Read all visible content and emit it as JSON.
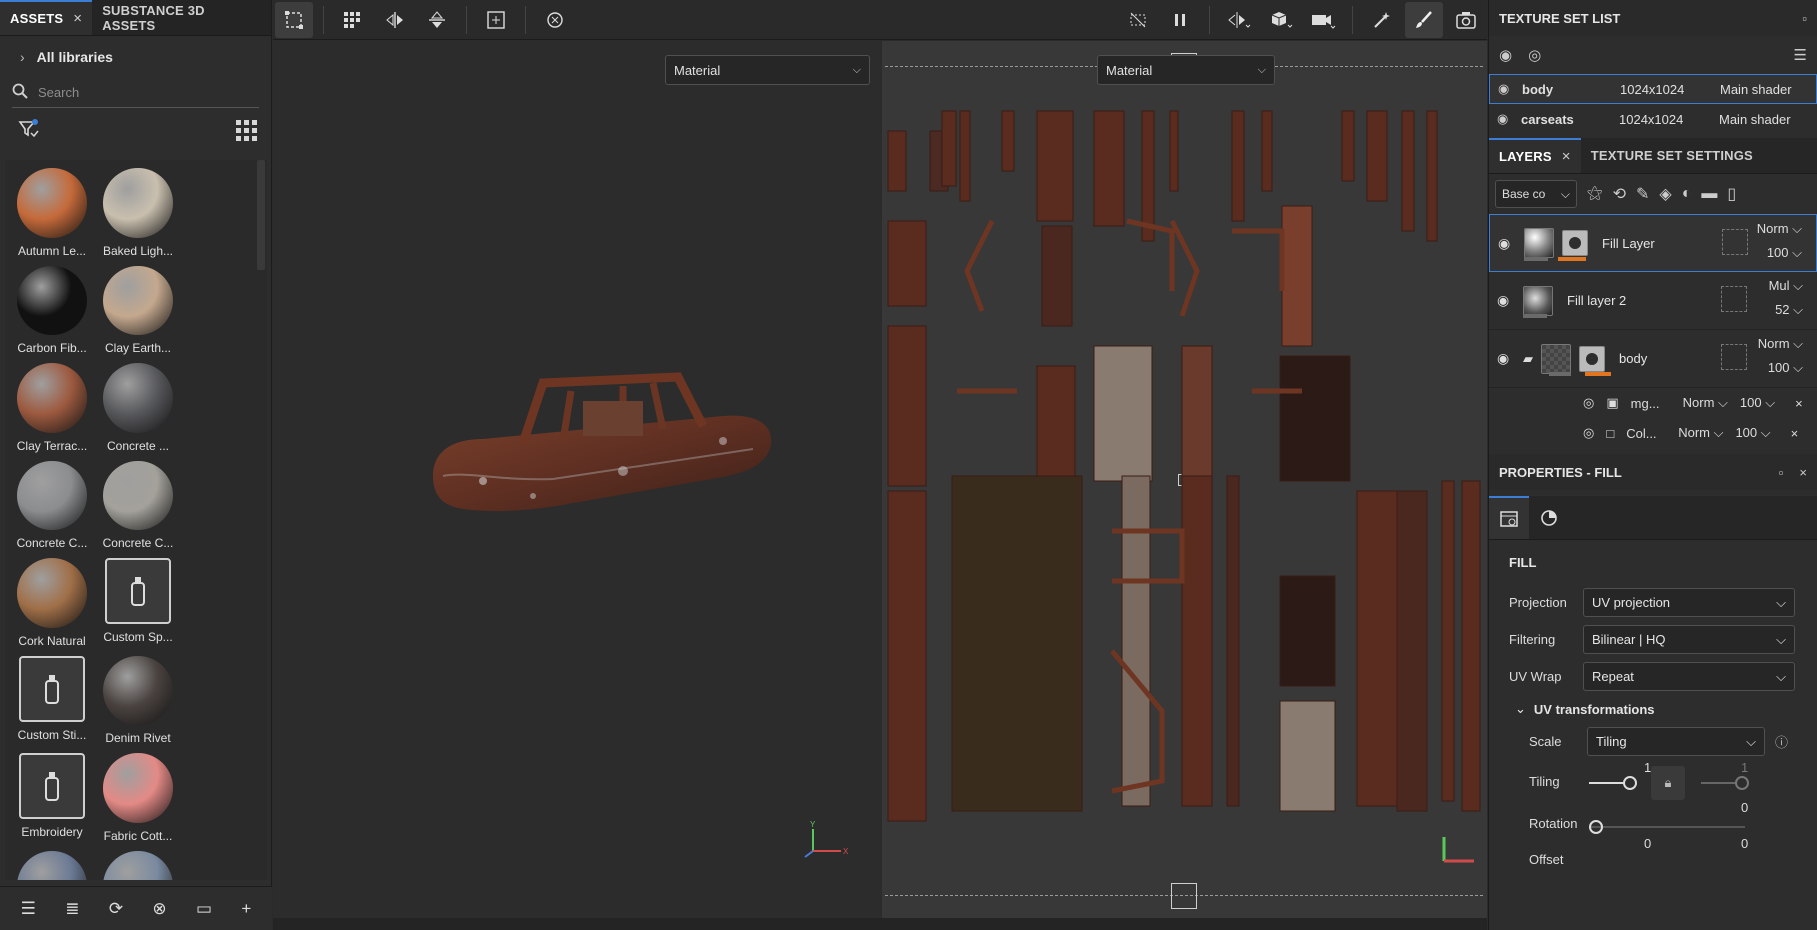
{
  "assets_panel": {
    "tab_assets": "ASSETS",
    "tab_substance": "SUBSTANCE 3D ASSETS",
    "close_glyph": "×",
    "libraries_label": "All libraries",
    "search_placeholder": "Search",
    "items": [
      {
        "name": "Autumn Le...",
        "color": "#c56a3a"
      },
      {
        "name": "Baked Ligh...",
        "color": "#c9bfae"
      },
      {
        "name": "Carbon Fib...",
        "color": "#111111"
      },
      {
        "name": "Clay Earth...",
        "color": "#c4a88e"
      },
      {
        "name": "Clay Terrac...",
        "color": "#9d5a40"
      },
      {
        "name": "Concrete ...",
        "color": "#58595c"
      },
      {
        "name": "Concrete C...",
        "color": "#8b8d8f"
      },
      {
        "name": "Concrete C...",
        "color": "#a3a19a"
      },
      {
        "name": "Cork Natural",
        "color": "#a06f48"
      },
      {
        "name": "Custom Sp...",
        "color": "square"
      },
      {
        "name": "Custom Sti...",
        "color": "square"
      },
      {
        "name": "Denim Rivet",
        "color": "#4a4340"
      },
      {
        "name": "Embroidery",
        "color": "square"
      },
      {
        "name": "Fabric Cott...",
        "color": "#e38a86"
      },
      {
        "name": "",
        "color": "#6b7a95"
      },
      {
        "name": "",
        "color": "#7a8aa0"
      }
    ]
  },
  "toolbar": {
    "icons": [
      "selection-tool-icon",
      "grid-select-icon",
      "symmetry-x-icon",
      "symmetry-y-icon",
      "frame-icon",
      "reset-camera-icon"
    ],
    "right_icons": [
      "hide-icon",
      "pause-icon",
      "split-view-icon",
      "cube-icon",
      "camera-icon",
      "effects-icon",
      "paint-brush-icon",
      "screenshot-icon"
    ]
  },
  "viewport3d": {
    "mode": "Material"
  },
  "viewport2d": {
    "mode": "Material"
  },
  "texture_sets": {
    "title": "TEXTURE SET LIST",
    "rows": [
      {
        "name": "body",
        "resolution": "1024x1024",
        "shader": "Main shader"
      },
      {
        "name": "carseats",
        "resolution": "1024x1024",
        "shader": "Main shader"
      }
    ]
  },
  "layers": {
    "tab_layers": "LAYERS",
    "tab_settings": "TEXTURE SET SETTINGS",
    "channel": "Base co",
    "items": [
      {
        "name": "Fill Layer",
        "blend": "Norm",
        "opacity": "100"
      },
      {
        "name": "Fill layer 2",
        "blend": "Mul",
        "opacity": "52"
      },
      {
        "name": "body",
        "blend": "Norm",
        "opacity": "100"
      }
    ],
    "sub_items": [
      {
        "name": "mg...",
        "blend": "Norm",
        "opacity": "100"
      },
      {
        "name": "Col...",
        "blend": "Norm",
        "opacity": "100"
      }
    ]
  },
  "properties": {
    "title": "PROPERTIES - FILL",
    "section": "FILL",
    "projection_label": "Projection",
    "projection_value": "UV projection",
    "filtering_label": "Filtering",
    "filtering_value": "Bilinear | HQ",
    "uvwrap_label": "UV Wrap",
    "uvwrap_value": "Repeat",
    "uv_transform_title": "UV transformations",
    "scale_label": "Scale",
    "scale_value": "Tiling",
    "tiling_label": "Tiling",
    "tiling_value": "1",
    "tiling_value_2": "1",
    "rotation_label": "Rotation",
    "rotation_value": "0",
    "offset_label": "Offset",
    "offset_x": "0",
    "offset_y": "0"
  }
}
